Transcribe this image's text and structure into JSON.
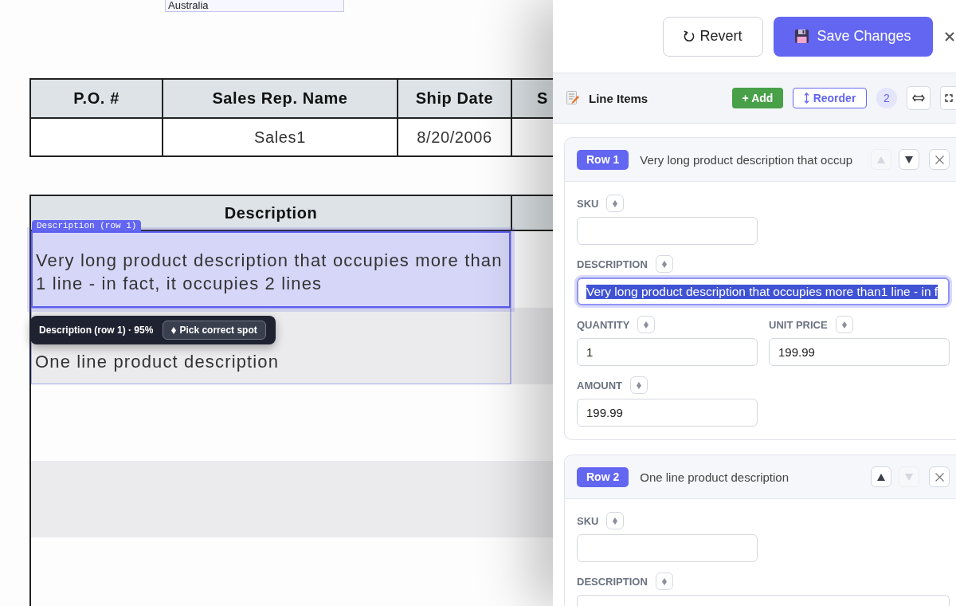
{
  "document": {
    "country_field": {
      "value": "Australia"
    },
    "order_table": {
      "columns": [
        "P.O. #",
        "Sales Rep. Name",
        "Ship Date",
        "S"
      ],
      "rows": [
        [
          null,
          "Sales1",
          "8/20/2006",
          null
        ]
      ]
    },
    "items_table": {
      "columns": [
        "Description"
      ],
      "rows": [
        {
          "description": "Very long product description that occupies more than 1 line - in fact, it occupies 2 lines",
          "selected": true,
          "outlined": false,
          "tag": "Description (row 1)"
        },
        {
          "description": "One line product description",
          "selected": false,
          "outlined": true
        }
      ]
    },
    "tooltip": {
      "text": "Description (row 1) · 95%",
      "button": "Pick correct spot"
    }
  },
  "panel": {
    "revert_button": "Revert",
    "save_button": "Save Changes",
    "section": {
      "title": "Line Items",
      "add_button": "+ Add",
      "reorder_button": "Reorder",
      "count": "2"
    },
    "line_items": [
      {
        "badge": "Row 1",
        "title": "Very long product description that occup",
        "up_disabled": true,
        "down_disabled": false,
        "fields": [
          {
            "label": "SKU",
            "kind": "short",
            "focused": false
          },
          {
            "label": "DESCRIPTION",
            "value": "Very long product description that occupies more than1 line - in f",
            "kind": "long",
            "focused": true,
            "text_selected": true
          },
          {
            "label": "QUANTITY",
            "value": "1",
            "kind": "short",
            "focused": false,
            "text_selected": false
          },
          {
            "label": "UNIT PRICE",
            "value": "199.99",
            "kind": "short",
            "focused": false,
            "text_selected": false
          },
          {
            "label": "AMOUNT",
            "value": "199.99",
            "kind": "short",
            "focused": false,
            "text_selected": false
          }
        ]
      },
      {
        "badge": "Row 2",
        "title": "One line product description",
        "up_disabled": false,
        "down_disabled": true,
        "fields": [
          {
            "label": "SKU",
            "kind": "short",
            "focused": false
          },
          {
            "label": "DESCRIPTION",
            "kind": "long",
            "focused": false
          }
        ]
      }
    ]
  }
}
